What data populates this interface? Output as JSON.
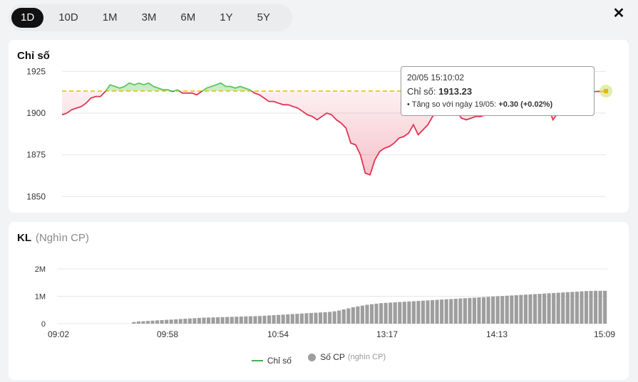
{
  "tabs": [
    {
      "label": "1D",
      "active": true
    },
    {
      "label": "10D",
      "active": false
    },
    {
      "label": "1M",
      "active": false
    },
    {
      "label": "3M",
      "active": false
    },
    {
      "label": "6M",
      "active": false
    },
    {
      "label": "1Y",
      "active": false
    },
    {
      "label": "5Y",
      "active": false
    }
  ],
  "close_label": "✕",
  "index_panel": {
    "title": "Chỉ số"
  },
  "volume_panel": {
    "title": "KL",
    "subtitle": "(Nghìn CP)"
  },
  "tooltip": {
    "time": "20/05 15:10:02",
    "label": "Chỉ số: ",
    "value": "1913.23",
    "compare_label": "Tăng so với ngày 19/05: ",
    "change": "+0.30 (+0.02%)"
  },
  "legend": {
    "index_label": "Chỉ số",
    "volume_label": "Số CP",
    "volume_unit": "(nghìn CP)"
  },
  "colors": {
    "up": "#5cc75c",
    "down": "#e0344f",
    "reference": "#e6b800",
    "volume": "#9e9e9e"
  },
  "chart_data": [
    {
      "type": "line",
      "title": "Chỉ số",
      "reference": 1913.23,
      "ylim": [
        1845,
        1932
      ],
      "yticks": [
        1850,
        1875,
        1900,
        1925
      ],
      "y": [
        1899,
        1900,
        1902,
        1903,
        1904,
        1906,
        1909,
        1910,
        1910,
        1913,
        1917,
        1916,
        1915,
        1916,
        1918,
        1917,
        1918,
        1917,
        1918,
        1916,
        1915,
        1914,
        1914,
        1913,
        1914,
        1912,
        1912,
        1912,
        1911,
        1913,
        1915,
        1916,
        1917,
        1918,
        1916,
        1916,
        1915,
        1916,
        1915,
        1914,
        1912,
        1911,
        1909,
        1907,
        1907,
        1906,
        1905,
        1905,
        1904,
        1903,
        1901,
        1899,
        1898,
        1896,
        1898,
        1900,
        1899,
        1896,
        1894,
        1891,
        1882,
        1881,
        1875,
        1864,
        1863,
        1872,
        1877,
        1879,
        1880,
        1882,
        1885,
        1886,
        1888,
        1893,
        1887,
        1890,
        1893,
        1898,
        1902,
        1905,
        1906,
        1903,
        1901,
        1897,
        1896,
        1897,
        1898,
        1898,
        1899,
        1901,
        1902,
        1903,
        1901,
        1899,
        1899,
        1900,
        1902,
        1903,
        1905,
        1906,
        1905,
        1904,
        1896,
        1900,
        1902,
        1903,
        1905,
        1910,
        1912,
        1913,
        1913,
        1913,
        1913,
        1913.23
      ]
    },
    {
      "type": "bar",
      "title": "KL",
      "ylabel": "(Nghìn CP)",
      "ylim": [
        0,
        2000000
      ],
      "yticks": [
        {
          "v": 0,
          "label": "0"
        },
        {
          "v": 1000000,
          "label": "1M"
        },
        {
          "v": 2000000,
          "label": "2M"
        }
      ],
      "x_ticks": [
        "09:02",
        "09:58",
        "10:54",
        "13:17",
        "14:13",
        "15:09"
      ],
      "values": [
        0,
        0,
        0,
        0,
        0,
        0,
        0,
        0,
        0,
        0,
        0,
        0,
        0,
        0,
        0,
        0,
        60000,
        80000,
        90000,
        100000,
        110000,
        120000,
        130000,
        140000,
        150000,
        160000,
        170000,
        180000,
        190000,
        200000,
        210000,
        220000,
        225000,
        230000,
        235000,
        240000,
        245000,
        250000,
        255000,
        260000,
        265000,
        270000,
        275000,
        280000,
        290000,
        300000,
        310000,
        320000,
        330000,
        340000,
        350000,
        360000,
        370000,
        380000,
        390000,
        400000,
        410000,
        420000,
        430000,
        450000,
        480000,
        520000,
        560000,
        600000,
        630000,
        660000,
        690000,
        710000,
        730000,
        750000,
        760000,
        770000,
        780000,
        790000,
        800000,
        810000,
        820000,
        830000,
        840000,
        850000,
        860000,
        870000,
        880000,
        890000,
        900000,
        910000,
        920000,
        930000,
        940000,
        950000,
        960000,
        970000,
        980000,
        990000,
        1000000,
        1010000,
        1020000,
        1030000,
        1040000,
        1050000,
        1060000,
        1070000,
        1080000,
        1090000,
        1100000,
        1110000,
        1120000,
        1130000,
        1140000,
        1150000,
        1160000,
        1170000,
        1180000,
        1190000,
        1195000,
        1200000,
        1200000,
        1200000
      ]
    }
  ]
}
